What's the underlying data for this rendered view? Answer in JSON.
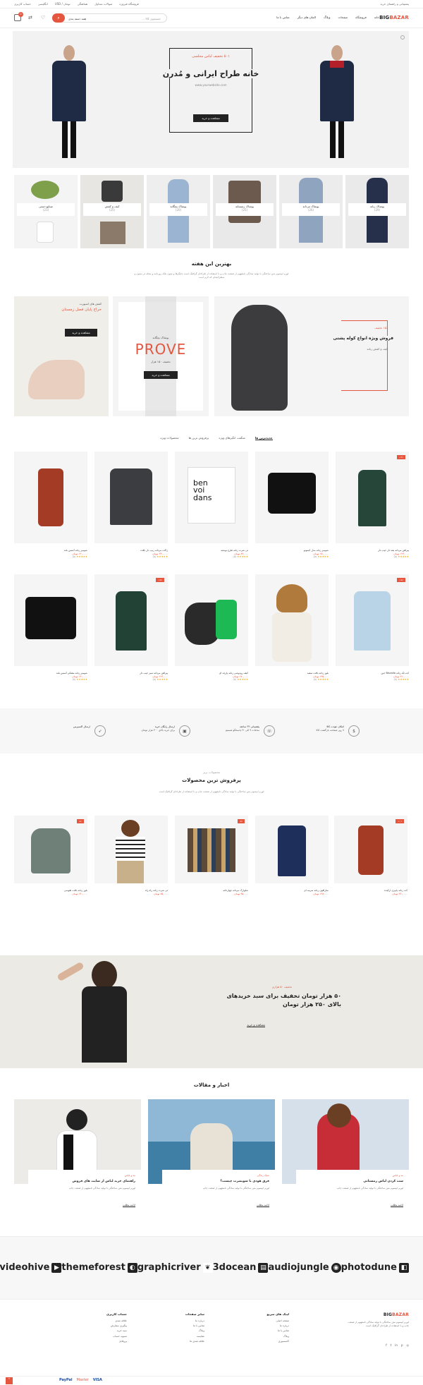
{
  "topbar": {
    "links_right": [
      "پشتیبانی و راهنمای خرید"
    ],
    "links_left": [
      "فروشگاه ‌فیروزه",
      "سوالات متداول",
      "هماهنگی",
      "تومان / USD",
      "انگلیسی",
      "حساب کاربری"
    ]
  },
  "header": {
    "logo_big": "BIG",
    "logo_bazar": "BAZAR",
    "nav": [
      "خانه",
      "فروشگاه",
      "صفحات",
      "وبلاگ",
      "المان های دیگر",
      "تماس با ما"
    ],
    "search_placeholder": "جستجوی کالا ...",
    "search_category": "همه دسته بندی",
    "cart_count": "0"
  },
  "hero": {
    "discount": "۵۰٪ تخفیف لباس مجلسی",
    "title": "خانه طراح ایرانی و مُدرن",
    "url": "www.yourwebsite.com",
    "button": "مشاهده و خرید"
  },
  "categories": [
    {
      "name": "پوشاک زنانه",
      "count": "(29)"
    },
    {
      "name": "پوشاک مردانه",
      "count": "(26)"
    },
    {
      "name": "پوشاک زمستانه",
      "count": "(25)"
    },
    {
      "name": "پوشاک بچگانه",
      "count": "(20)"
    },
    {
      "name": "کیف و کفش",
      "count": "(25)"
    },
    {
      "name": "صنایع دستی",
      "count": "(23)"
    }
  ],
  "weekly": {
    "title": "بهترین این هفته",
    "desc": "لورم ایپسوم متن ساختگی با تولید سادگی نامفهوم از صنعت چاپ و با استفاده از طراحان گرافیک است چاپگرها و متون بلکه روزنامه و مجله در ستون و سطرآنچنان که لازم است"
  },
  "promos": {
    "backpack_discount": "۱۵٪ تخفیف",
    "backpack_title": "فروش ویژه انواع کوله پشتی",
    "backpack_sub": "کیف و کفش زنانه",
    "prove_small": "پوشاک بچگانه",
    "prove_title": "PROVE",
    "prove_price": "تخفیف ۱۵۰ هزار",
    "prove_button": "مشاهده و خرید",
    "shoe_small": "کفش های اسپورت",
    "shoe_title": "حراج پایان فصل زمستان",
    "shoe_button": "مشاهده و خرید"
  },
  "tabs": [
    "جدیدترین ها",
    "شگفت انگیزهای ویژه",
    "پرفروش ترین ها",
    "محصولات ویژه"
  ],
  "products_row1": [
    {
      "name": "پیراهن مردانه یقه دار جیب دار",
      "price": "۱۲۶,۰۰۰ تومان",
      "rating": "(۵)",
      "sale": "-۱۲٪"
    },
    {
      "name": "شومیز زنانه مدل کیمونو",
      "price": "۱۵۰,۰۰۰ تومان",
      "rating": "(۵)",
      "sale": ""
    },
    {
      "name": "تی شرت زنانه طرح نوشته",
      "price": "۸۹,۰۰۰ تومان",
      "rating": "(۵)",
      "sale": ""
    },
    {
      "name": "ژاکت مردانه زیپ دار بافت",
      "price": "۲۳۰,۰۰۰ تومان",
      "rating": "(۵)",
      "sale": ""
    },
    {
      "name": "شومیز زنانه آستین بلند",
      "price": "۱۲۰,۰۰۰ تومان",
      "rating": "(۵)",
      "sale": ""
    }
  ],
  "products_row2": [
    {
      "name": "کت تک زنانه Biscallo جین",
      "price": "۳۱۰,۰۰۰ تومان",
      "rating": "(۵)",
      "sale": "-۱۵٪"
    },
    {
      "name": "بلوز زنانه بافت سفید",
      "price": "۱۴۵,۰۰۰ تومان",
      "rating": "(۵)",
      "sale": ""
    },
    {
      "name": "کیف رودوشی زنانه پارچه ای",
      "price": "۱۷۰,۰۰۰ تومان",
      "rating": "(۵)",
      "sale": ""
    },
    {
      "name": "پیراهن مردانه سبز جیب دار",
      "price": "۱۲۶,۰۰۰ تومان",
      "rating": "(۵)",
      "sale": "-۱۸٪"
    },
    {
      "name": "شومیز زنانه مشکی آستین بلند",
      "price": "۱۳۰,۰۰۰ تومان",
      "rating": "(۵)",
      "sale": ""
    }
  ],
  "features": [
    {
      "title": "امکان عودت کالا",
      "desc": "۷ روز ضمانت بازگشت کالا"
    },
    {
      "title": "پشتیبانی ۲۴ ساعته",
      "desc": "ساعات ۹ الی ۲۱ پاسخگو هستیم"
    },
    {
      "title": "ارسال رایگان خرید",
      "desc": "برای خرید بالای ۳۰۰ هزار تومان"
    },
    {
      "title": "ارسال اکسپرس",
      "desc": ""
    }
  ],
  "bestsellers": {
    "small": "محصولات برتر",
    "title": "پرفروش ترین محصولات",
    "desc": "لورم ایپسوم متن ساختگی با تولید سادگی نامفهوم از صنعت چاپ و با استفاده از طراحان گرافیک است",
    "items": [
      {
        "name": "کت زنانه پاییزی ارکیده",
        "price": "۲۲۰,۰۰۰ تومان",
        "sale": "-۱۰٪"
      },
      {
        "name": "سارافون زنانه سرمه ای",
        "price": "۱۹۸,۰۰۰ تومان",
        "sale": ""
      },
      {
        "name": "شلوارک مردانه چهارخانه",
        "price": "۹۵,۰۰۰ تومان",
        "sale": "-۵٪"
      },
      {
        "name": "تی شرت زنانه راه راه",
        "price": "۸۵,۰۰۰ تومان",
        "sale": ""
      },
      {
        "name": "بلوز زنانه بافت طوسی",
        "price": "۱۴۰,۰۰۰ تومان",
        "sale": "-۸٪"
      }
    ]
  },
  "banner": {
    "small": "تخفیف ۵۰ هزاری",
    "title": "۵۰ هزار تومان تخفیف برای سبد خریدهای بالای ۲۵۰ هزار تومان",
    "button": "مشاهده و خرید"
  },
  "blog": {
    "title": "اخبار و مقالات",
    "posts": [
      {
        "cat": "مد و لباس",
        "title": "ست کردن لباس زمستانی",
        "text": "لورم ایپسوم متن ساختگی با تولید سادگی نامفهوم از صنعت چاپ",
        "more": "ادامه مطلب"
      },
      {
        "cat": "سبک زندگی",
        "title": "فرق هودی با سویشرت چیست؟",
        "text": "لورم ایپسوم متن ساختگی با تولید سادگی نامفهوم از صنعت چاپ",
        "more": "ادامه مطلب"
      },
      {
        "cat": "مد و لباس",
        "title": "راهنمای خرید لباس از سایت های فروش",
        "text": "لورم ایپسوم متن ساختگی با تولید سادگی نامفهوم از صنعت چاپ",
        "more": "ادامه مطلب"
      }
    ]
  },
  "brands": [
    "photodune",
    "audiojungle",
    "3docean",
    "graphicriver",
    "themeforest",
    "videohive"
  ],
  "footer": {
    "about": "لورم ایپسوم متن ساختگی با تولید سادگی نامفهوم از صنعت چاپ و با استفاده از طراحان گرافیک است",
    "col1_title": "لینک های سریع",
    "col1": [
      "صفحه اصلی",
      "درباره ما",
      "تماس با ما",
      "وبلاگ",
      "اکسسوری"
    ],
    "col2_title": "سایر صفحات",
    "col2": [
      "درباره ما",
      "تماس با ما",
      "وبلاگ",
      "مقایسه",
      "علاقه مندی ها"
    ],
    "col3_title": "حساب کاربری",
    "col3": [
      "علاقه مندی",
      "پیگیری سفارش",
      "سبد خرید",
      "تسویه حساب",
      "پروفایل"
    ],
    "payments": [
      "PayPal",
      "Master",
      "VISA"
    ]
  },
  "colors": {
    "accent": "#e5563f",
    "dark": "#222222",
    "bg": "#f5f5f5"
  }
}
